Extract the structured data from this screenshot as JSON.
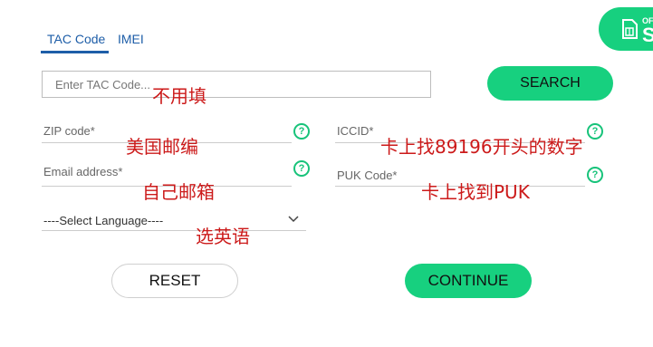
{
  "tabs": [
    {
      "label": "TAC Code",
      "active": true
    },
    {
      "label": "IMEI",
      "active": false
    }
  ],
  "badge": {
    "small_text": "OF",
    "big_text": "S",
    "icon": "sim-card-icon"
  },
  "tac": {
    "placeholder": "Enter TAC Code...",
    "search_label": "SEARCH"
  },
  "fields": {
    "zip": "ZIP code*",
    "email": "Email address*",
    "iccid": "ICCID*",
    "puk": "PUK Code*",
    "language": "----Select Language----"
  },
  "help_glyph": "?",
  "buttons": {
    "reset": "RESET",
    "continue": "CONTINUE"
  },
  "annotations": {
    "tac": "不用填",
    "zip": "美国邮编",
    "email": "自己邮箱",
    "language": "选英语",
    "iccid": "卡上找89196开头的数字",
    "puk": "卡上找到PUK"
  },
  "colors": {
    "accent_green": "#17d07f",
    "tab_blue": "#1e5ea8",
    "annotation_red": "#cc1a1a"
  }
}
